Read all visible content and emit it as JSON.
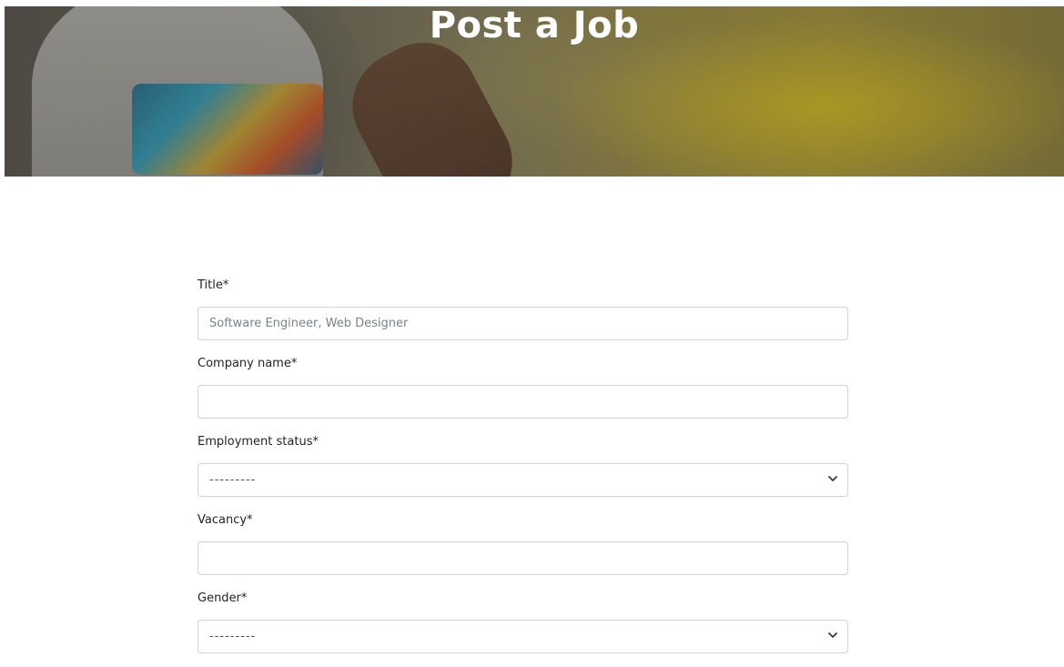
{
  "hero": {
    "title": "Post a Job"
  },
  "form": {
    "fields": [
      {
        "label": "Title*",
        "type": "text",
        "placeholder": "Software Engineer, Web Designer",
        "value": ""
      },
      {
        "label": "Company name*",
        "type": "text",
        "placeholder": "",
        "value": ""
      },
      {
        "label": "Employment status*",
        "type": "select",
        "selected": "---------"
      },
      {
        "label": "Vacancy*",
        "type": "text",
        "placeholder": "",
        "value": ""
      },
      {
        "label": "Gender*",
        "type": "select",
        "selected": "---------"
      }
    ]
  },
  "icons": {
    "select_arrow": "chevron-down-icon"
  },
  "colors": {
    "input_border": "#ced4da",
    "label_text": "#212529",
    "hero_title": "#ffffff"
  }
}
